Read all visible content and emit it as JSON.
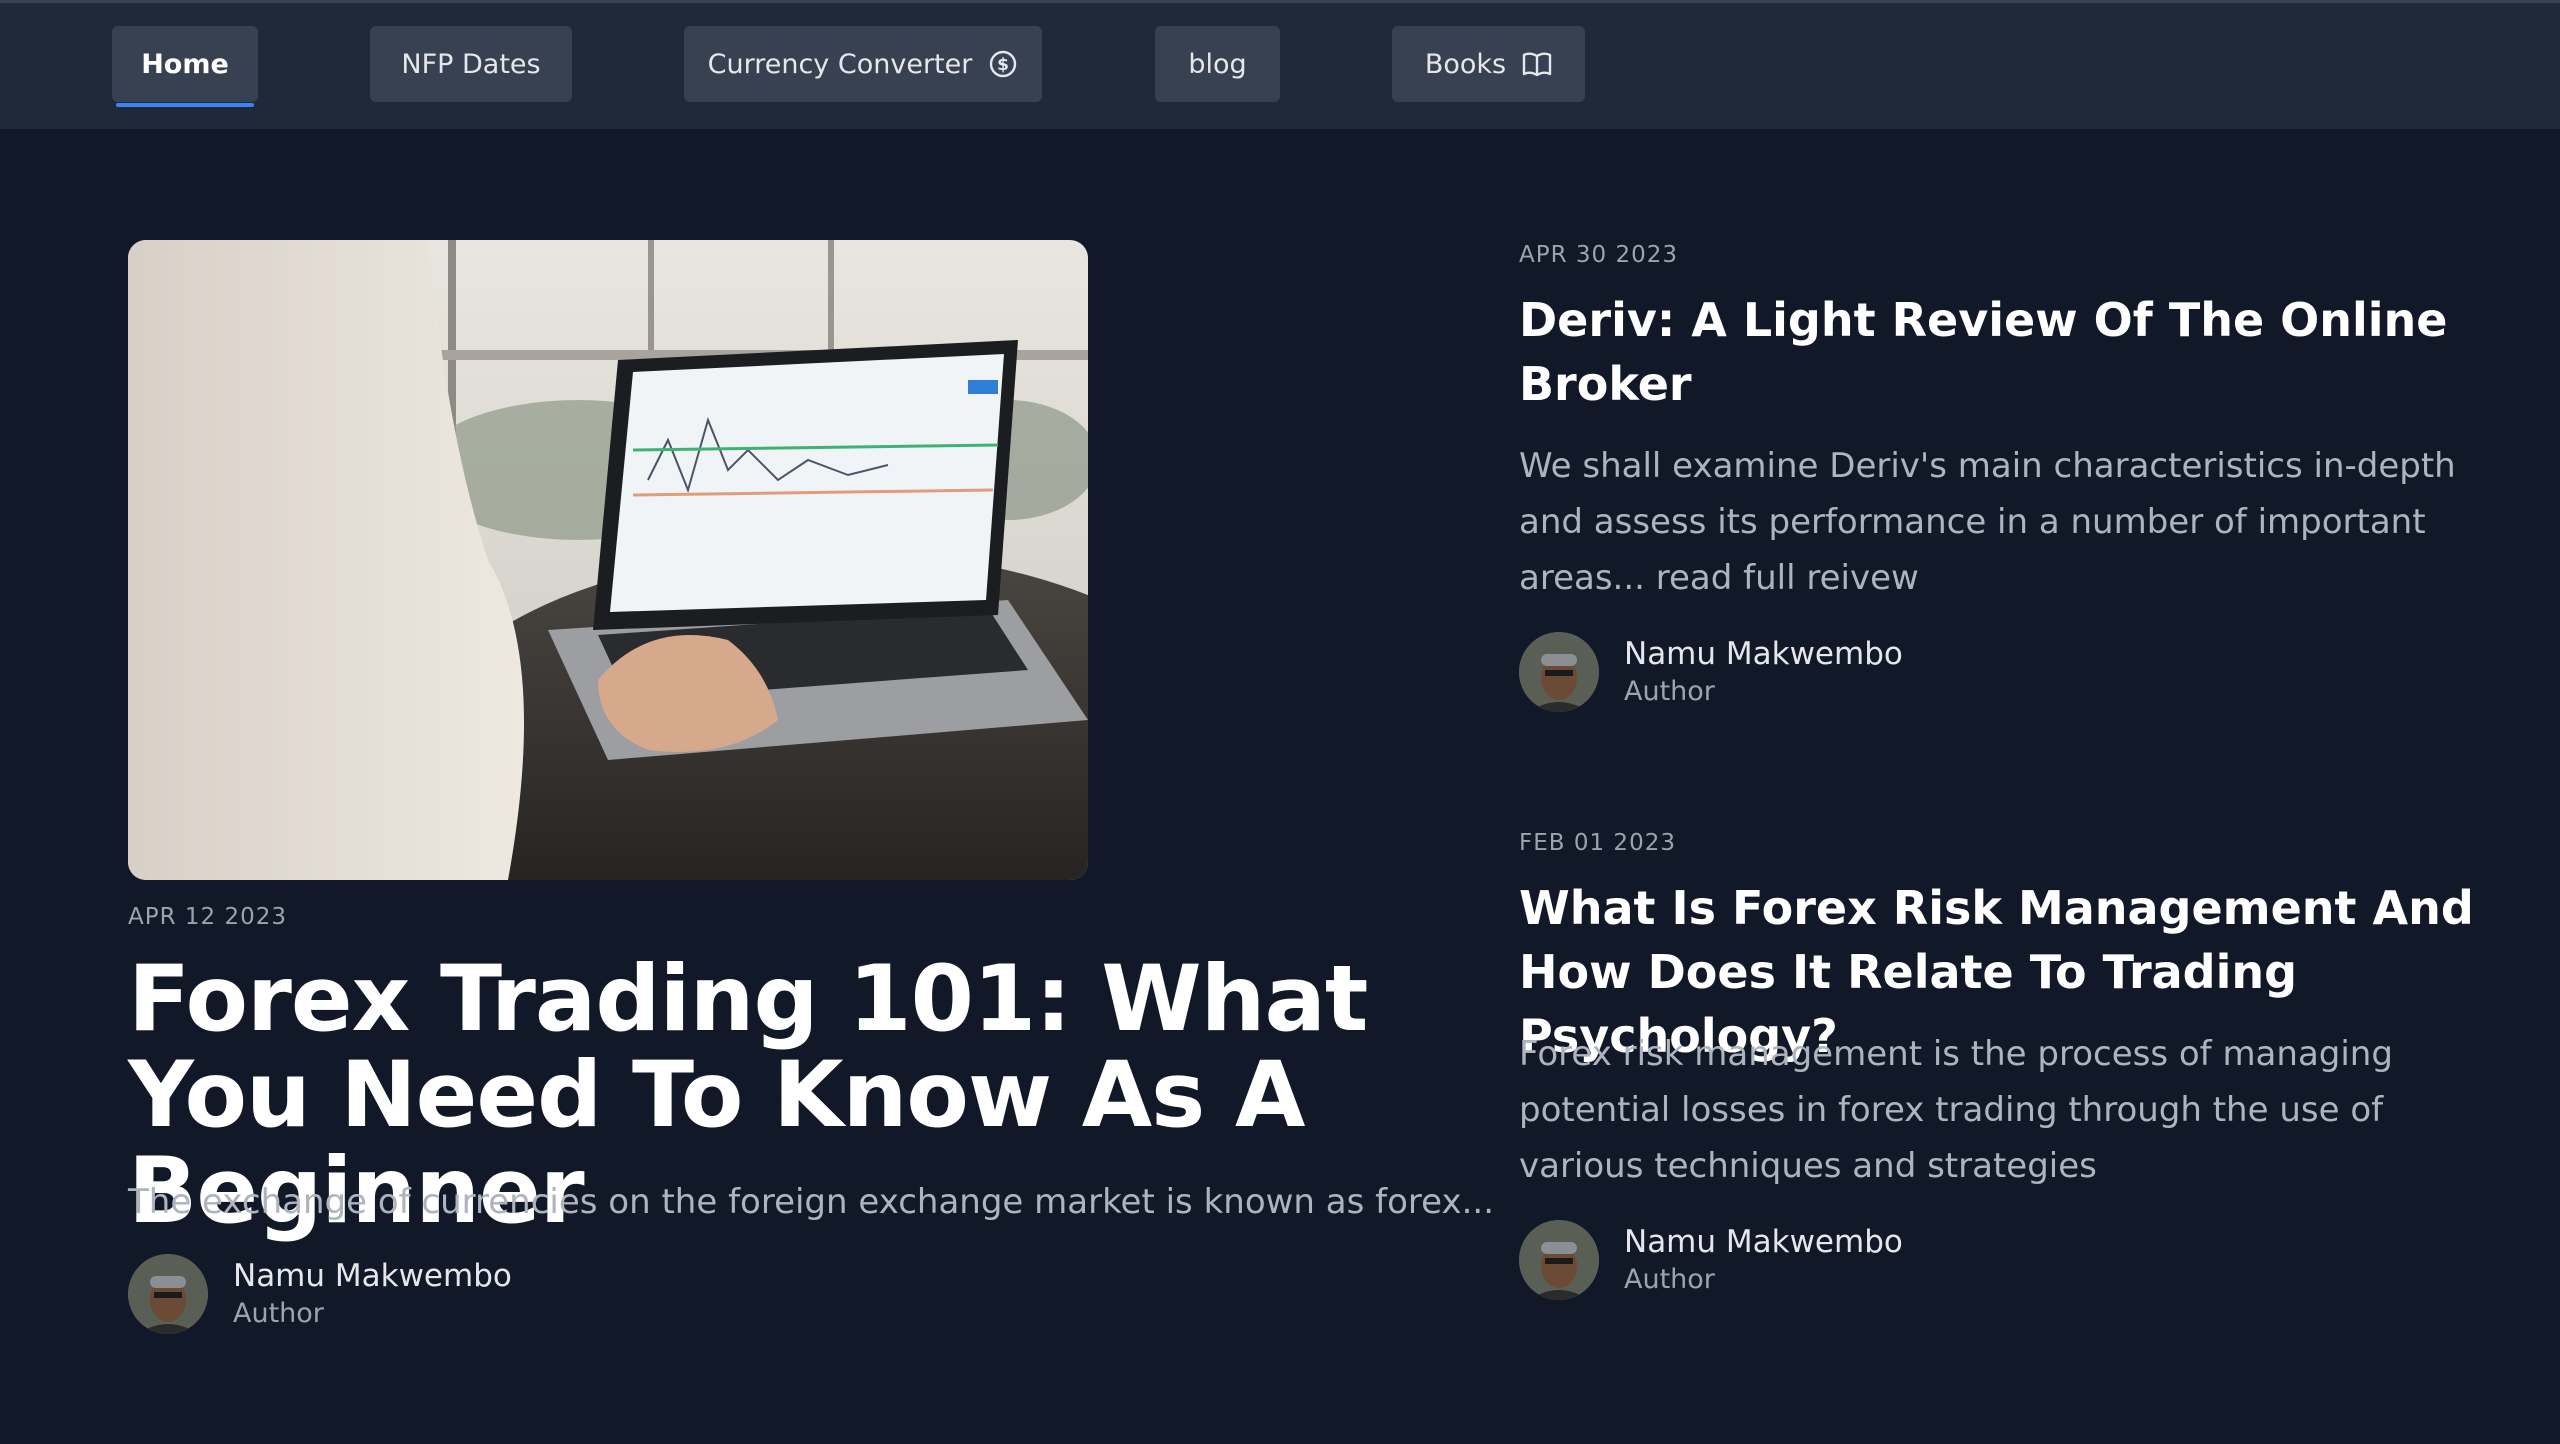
{
  "nav": {
    "items": [
      {
        "label": "Home"
      },
      {
        "label": "NFP Dates"
      },
      {
        "label": "Currency Converter",
        "icon": "dollar-circle-icon"
      },
      {
        "label": "blog"
      },
      {
        "label": "Books",
        "icon": "book-open-icon"
      }
    ],
    "active_accent": "#3b82f6"
  },
  "featured": {
    "date": "APR 12 2023",
    "title": "Forex Trading 101: What You Need To Know As A Beginner",
    "excerpt": "The exchange of currencies on the foreign exchange market is known as forex...",
    "author": {
      "name": "Namu Makwembo",
      "role": "Author"
    }
  },
  "posts": [
    {
      "date": "APR 30 2023",
      "title": "Deriv: A Light Review Of The Online Broker",
      "excerpt": "We shall examine Deriv's main characteristics in-depth and assess its performance in a number of important areas... read full reivew",
      "author": {
        "name": "Namu Makwembo",
        "role": "Author"
      }
    },
    {
      "date": "FEB 01 2023",
      "title": "What Is Forex Risk Management And How Does It Relate To Trading Psychology?",
      "excerpt": "Forex risk management is the process of managing potential losses in forex trading through the use of various techniques and strategies",
      "author": {
        "name": "Namu Makwembo",
        "role": "Author"
      }
    }
  ],
  "colors": {
    "page_bg": "#111827",
    "navbar_bg": "#1f2937",
    "button_bg": "#374151"
  }
}
